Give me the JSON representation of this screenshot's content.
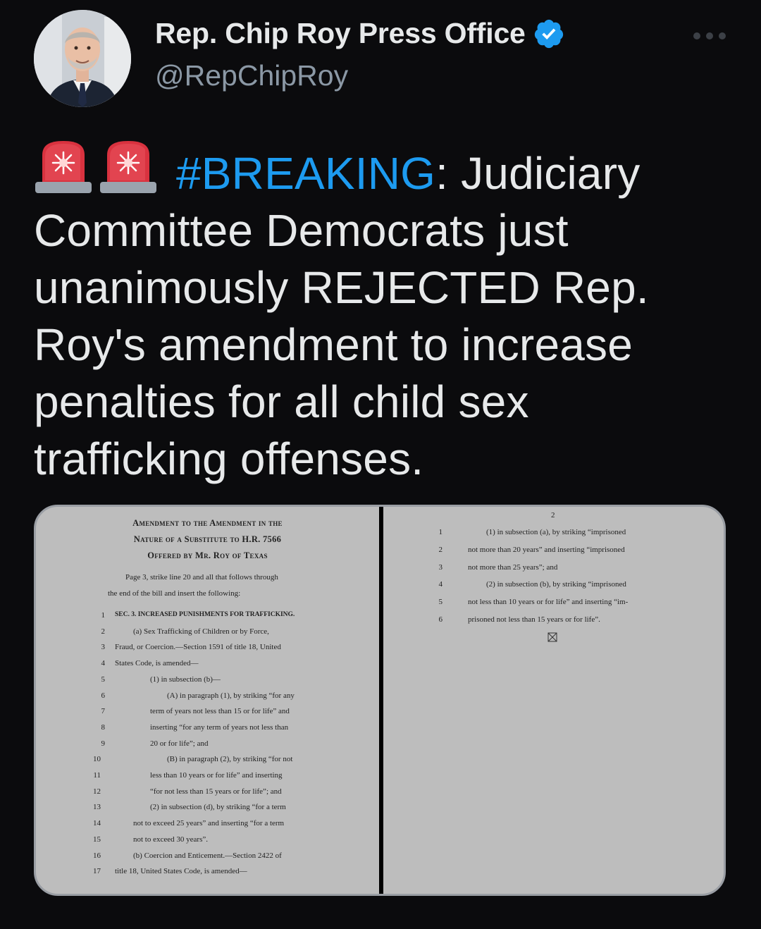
{
  "tweet": {
    "author_name": "Rep. Chip Roy Press Office",
    "handle": "@RepChipRoy",
    "hashtag": "#BREAKING",
    "text_after_hashtag": ": Judiciary Committee Democrats just unanimously REJECTED Rep. Roy's amendment to increase penalties for all child sex trafficking offenses.",
    "icons": {
      "avatar": "avatar",
      "verified": "verified-badge-icon",
      "more": "more-options-icon",
      "emoji": "police-light-emoji"
    },
    "colors": {
      "hashtag": "#1d9bf0",
      "verified": "#1d9bf0",
      "background": "#0b0b0d"
    }
  },
  "document": {
    "page1": {
      "header_lines": [
        "Amendment to the Amendment in the",
        "Nature of a Substitute to H.R. 7566",
        "Offered by Mr. Roy of Texas"
      ],
      "intro_lines": [
        "Page 3, strike line 20 and all that follows through",
        "the end of the bill and insert the following:"
      ],
      "lines": [
        {
          "n": "1",
          "text": "SEC. 3. INCREASED PUNISHMENTS FOR TRAFFICKING."
        },
        {
          "n": "2",
          "text": "(a) Sex Trafficking of Children or by Force,"
        },
        {
          "n": "3",
          "text": "Fraud, or Coercion.—Section 1591 of title 18, United"
        },
        {
          "n": "4",
          "text": "States Code, is amended—"
        },
        {
          "n": "5",
          "text": "(1) in subsection (b)—"
        },
        {
          "n": "6",
          "text": "(A) in paragraph (1), by striking “for any"
        },
        {
          "n": "7",
          "text": "term of years not less than 15 or for life” and"
        },
        {
          "n": "8",
          "text": "inserting “for any term of years not less than"
        },
        {
          "n": "9",
          "text": "20 or for life”; and"
        },
        {
          "n": "10",
          "text": "(B) in paragraph (2), by striking “for not"
        },
        {
          "n": "11",
          "text": "less than 10 years or for life” and inserting"
        },
        {
          "n": "12",
          "text": "“for not less than 15 years or for life”; and"
        },
        {
          "n": "13",
          "text": "(2) in subsection (d), by striking “for a term"
        },
        {
          "n": "14",
          "text": "not to exceed 25 years” and inserting “for a term"
        },
        {
          "n": "15",
          "text": "not to exceed 30 years”."
        },
        {
          "n": "16",
          "text": "(b) Coercion and Enticement.—Section 2422 of"
        },
        {
          "n": "17",
          "text": "title 18, United States Code, is amended—"
        }
      ]
    },
    "page2": {
      "page_number": "2",
      "lines": [
        {
          "n": "1",
          "text": "(1) in subsection (a), by striking “imprisoned"
        },
        {
          "n": "2",
          "text": "not more than 20 years” and inserting “imprisoned"
        },
        {
          "n": "3",
          "text": "not more than 25 years”; and"
        },
        {
          "n": "4",
          "text": "(2) in subsection (b), by striking “imprisoned"
        },
        {
          "n": "5",
          "text": "not less than 10 years or for life” and inserting “im-"
        },
        {
          "n": "6",
          "text": "prisoned not less than 15 years or for life”."
        }
      ]
    }
  }
}
